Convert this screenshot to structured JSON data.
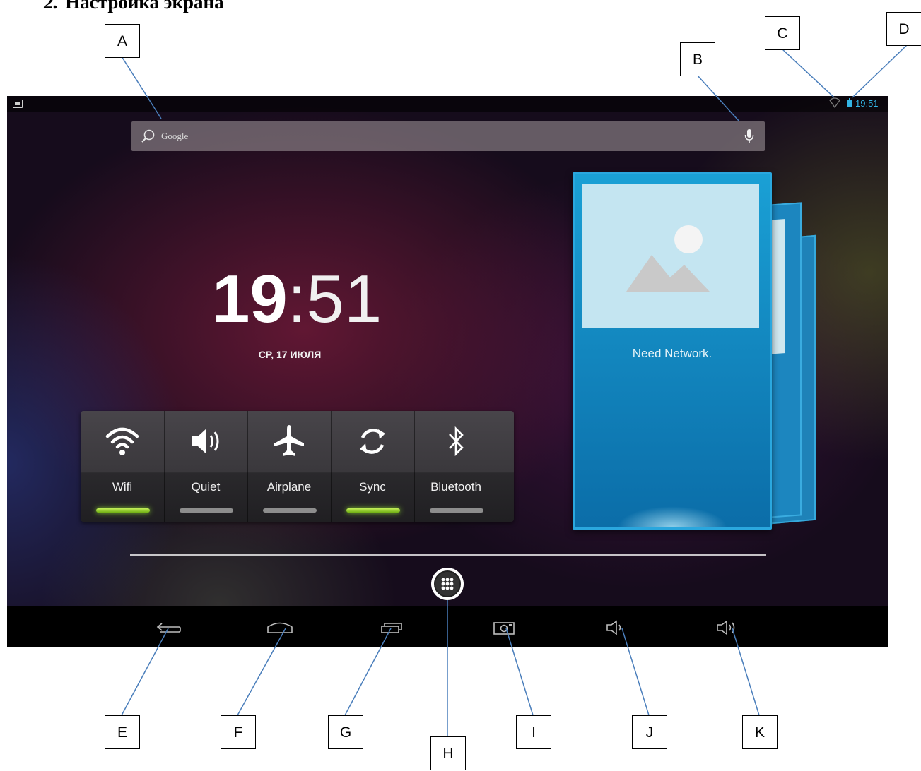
{
  "document": {
    "section_number": "2.",
    "section_title": "Настройка экрана"
  },
  "status_bar": {
    "time": "19:51",
    "icons": [
      "notification-icon",
      "wifi-signal-icon",
      "battery-icon"
    ]
  },
  "search": {
    "placeholder": "Google",
    "icons": [
      "search-icon",
      "microphone-icon"
    ]
  },
  "clock": {
    "hours": "19",
    "separator": ":",
    "minutes": "51",
    "date": "СР, 17 ИЮЛЯ"
  },
  "power_widget": {
    "items": [
      {
        "label": "Wifi",
        "icon": "wifi-icon",
        "active": true
      },
      {
        "label": "Quiet",
        "icon": "speaker-icon",
        "active": false
      },
      {
        "label": "Airplane",
        "icon": "airplane-icon",
        "active": false
      },
      {
        "label": "Sync",
        "icon": "sync-icon",
        "active": true
      },
      {
        "label": "Bluetooth",
        "icon": "bluetooth-icon",
        "active": false
      }
    ],
    "active_color": "#8fd930",
    "inactive_color": "#8d8d8d"
  },
  "photo_widget": {
    "caption": "Need Network.",
    "accent": "#1aa0d5"
  },
  "nav_bar": {
    "buttons": [
      "back-icon",
      "home-icon",
      "recent-apps-icon",
      "screenshot-icon",
      "volume-down-icon",
      "volume-up-icon"
    ]
  },
  "callouts": {
    "A": "A",
    "B": "B",
    "C": "C",
    "D": "D",
    "E": "E",
    "F": "F",
    "G": "G",
    "H": "H",
    "I": "I",
    "J": "J",
    "K": "K"
  },
  "colors": {
    "status_accent": "#33b5e5"
  }
}
